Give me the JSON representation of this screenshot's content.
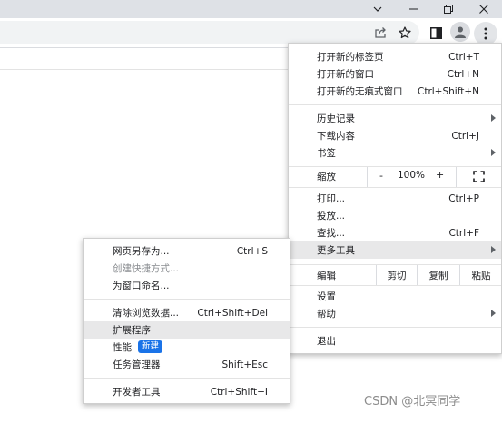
{
  "main_menu": {
    "items_top": [
      {
        "label": "打开新的标签页",
        "shortcut": "Ctrl+T"
      },
      {
        "label": "打开新的窗口",
        "shortcut": "Ctrl+N"
      },
      {
        "label": "打开新的无痕式窗口",
        "shortcut": "Ctrl+Shift+N"
      }
    ],
    "history": {
      "label": "历史记录"
    },
    "downloads": {
      "label": "下载内容",
      "shortcut": "Ctrl+J"
    },
    "bookmarks": {
      "label": "书签"
    },
    "zoom": {
      "label": "缩放",
      "minus": "-",
      "value": "100%",
      "plus": "+"
    },
    "print": {
      "label": "打印...",
      "shortcut": "Ctrl+P"
    },
    "cast": {
      "label": "投放..."
    },
    "find": {
      "label": "查找...",
      "shortcut": "Ctrl+F"
    },
    "more_tools": {
      "label": "更多工具"
    },
    "edit": {
      "label": "编辑",
      "cut": "剪切",
      "copy": "复制",
      "paste": "粘贴"
    },
    "settings": {
      "label": "设置"
    },
    "help": {
      "label": "帮助"
    },
    "exit": {
      "label": "退出"
    }
  },
  "sub_menu": {
    "save_as": {
      "label": "网页另存为...",
      "shortcut": "Ctrl+S"
    },
    "create_shortcut": {
      "label": "创建快捷方式..."
    },
    "name_window": {
      "label": "为窗口命名..."
    },
    "clear_data": {
      "label": "清除浏览数据...",
      "shortcut": "Ctrl+Shift+Del"
    },
    "extensions": {
      "label": "扩展程序"
    },
    "performance": {
      "label": "性能",
      "badge": "新建"
    },
    "task_manager": {
      "label": "任务管理器",
      "shortcut": "Shift+Esc"
    },
    "dev_tools": {
      "label": "开发者工具",
      "shortcut": "Ctrl+Shift+I"
    }
  },
  "watermark": "CSDN @北冥同学",
  "colors": {
    "accent": "#1a73e8",
    "titlebar": "#dee1e6",
    "highlight": "#e8e8e9"
  }
}
